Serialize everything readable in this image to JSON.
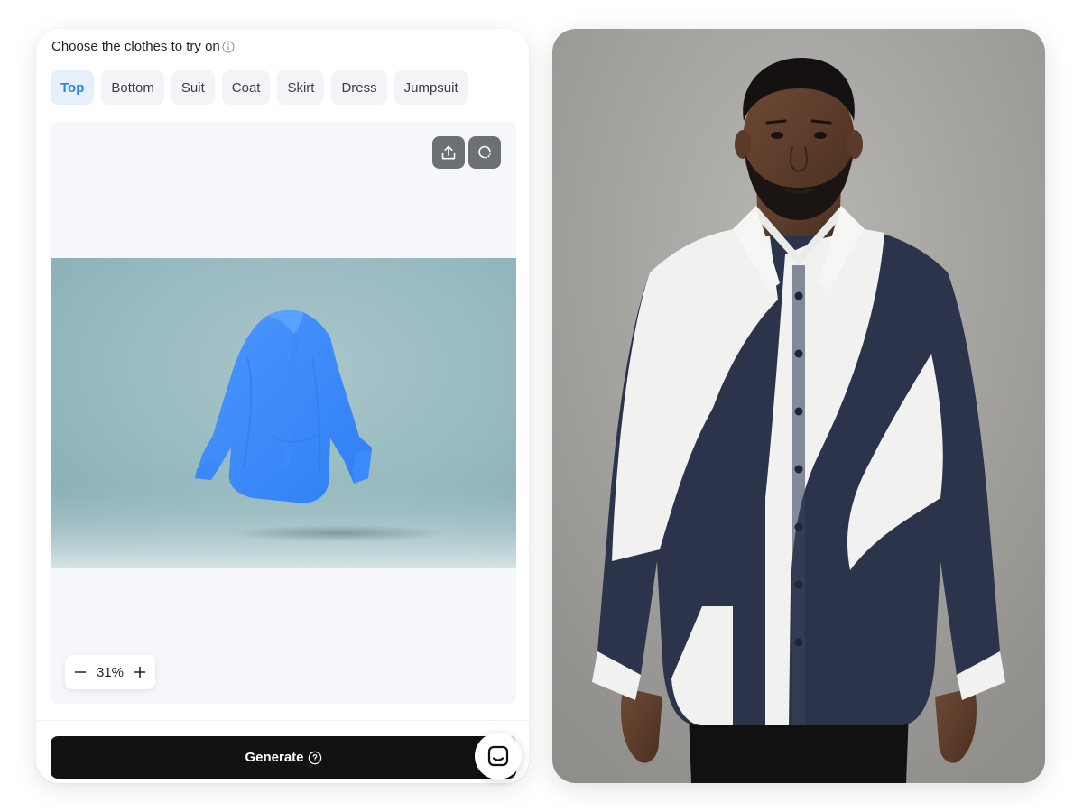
{
  "panel": {
    "title": "Choose the clothes to try on",
    "info_icon": "info-icon"
  },
  "tabs": [
    {
      "label": "Top",
      "active": true
    },
    {
      "label": "Bottom",
      "active": false
    },
    {
      "label": "Suit",
      "active": false
    },
    {
      "label": "Coat",
      "active": false
    },
    {
      "label": "Skirt",
      "active": false
    },
    {
      "label": "Dress",
      "active": false
    },
    {
      "label": "Jumpsuit",
      "active": false
    }
  ],
  "canvas": {
    "upload_icon": "upload-icon",
    "refresh_icon": "refresh-icon",
    "garment": "blue long-sleeve shirt"
  },
  "zoom": {
    "value": "31%",
    "minus_icon": "minus-icon",
    "plus_icon": "plus-icon"
  },
  "generate": {
    "label": "Generate",
    "help_icon": "question-circle-icon"
  },
  "chat": {
    "icon": "chat-icon"
  },
  "result": {
    "description": "model wearing navy and white patterned shirt"
  },
  "colors": {
    "accent": "#2c86e8",
    "tab_active_bg": "#e6f0fd",
    "generate_bg": "#111214",
    "shirt_blue": "#3b8cff",
    "shirt_navy": "#2c344c"
  }
}
